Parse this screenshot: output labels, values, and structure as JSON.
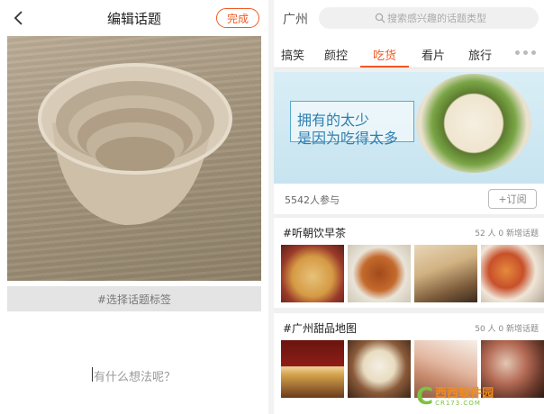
{
  "left_panel": {
    "header": {
      "title": "编辑话题",
      "done_label": "完成"
    },
    "tag_selector": "#选择话题标签",
    "thought_placeholder": "有什么想法呢？"
  },
  "right_panel": {
    "city": "广州",
    "search_placeholder": "搜索感兴趣的话题类型",
    "tabs": [
      {
        "label": "搞笑",
        "active": false
      },
      {
        "label": "颜控",
        "active": false
      },
      {
        "label": "吃货",
        "active": true
      },
      {
        "label": "看片",
        "active": false
      },
      {
        "label": "旅行",
        "active": false
      }
    ],
    "banner": {
      "line1": "拥有的太少",
      "line2": "是因为吃得太多"
    },
    "participants": "5542人参与",
    "subscribe_label": "+订阅",
    "topics": [
      {
        "title": "#听朝饮早茶",
        "meta": "52 人  0 新增话题"
      },
      {
        "title": "#广州甜品地图",
        "meta": "50 人  0 新增话题"
      }
    ]
  },
  "watermark": {
    "brand": "西西软件园",
    "site": "CR173.COM"
  },
  "colors": {
    "accent": "#f15a24",
    "watermark_green": "#7dc243",
    "watermark_orange": "#f28c1a"
  }
}
